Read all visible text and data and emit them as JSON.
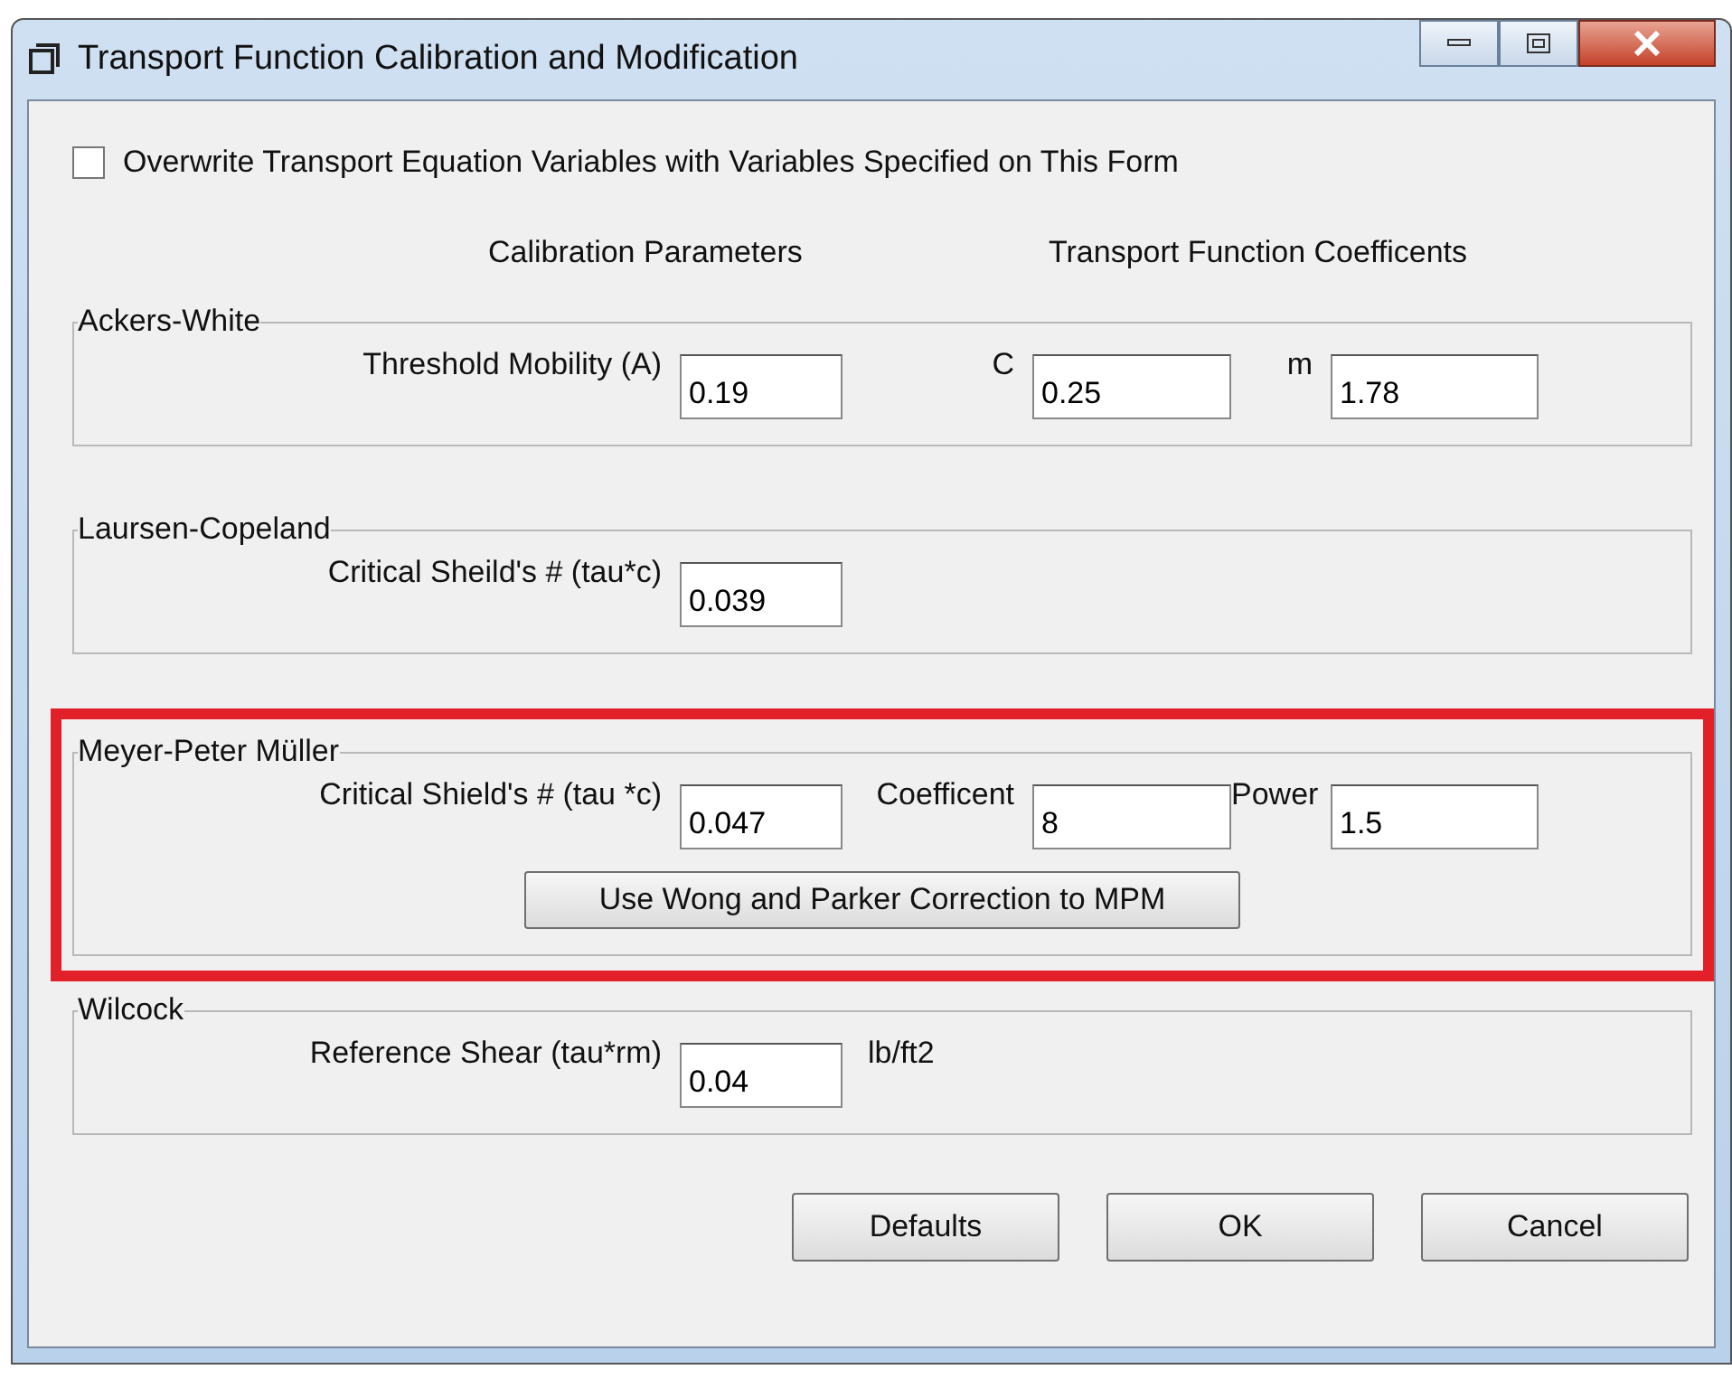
{
  "window": {
    "title": "Transport Function Calibration and Modification"
  },
  "overwrite": {
    "label": "Overwrite Transport Equation Variables with Variables Specified on This Form",
    "checked": false
  },
  "column_headers": [
    "Calibration Parameters",
    "Transport Function Coefficents"
  ],
  "groups": [
    {
      "title": "Ackers-White",
      "highlighted": false,
      "fields": [
        {
          "label": "Threshold Mobility (A)",
          "value": "0.19"
        },
        {
          "label": "C",
          "value": "0.25"
        },
        {
          "label": "m",
          "value": "1.78"
        }
      ]
    },
    {
      "title": "Laursen-Copeland",
      "highlighted": false,
      "fields": [
        {
          "label": "Critical Sheild's # (tau*c)",
          "value": "0.039"
        }
      ]
    },
    {
      "title": "Meyer-Peter Müller",
      "highlighted": true,
      "fields": [
        {
          "label": "Critical Shield's # (tau *c)",
          "value": "0.047"
        },
        {
          "label": "Coefficent",
          "value": "8"
        },
        {
          "label": "Power",
          "value": "1.5"
        }
      ],
      "button": "Use Wong and Parker Correction to MPM"
    },
    {
      "title": "Wilcock",
      "highlighted": false,
      "fields": [
        {
          "label": "Reference Shear (tau*rm)",
          "value": "0.04",
          "unit": "lb/ft2"
        }
      ]
    }
  ],
  "buttons": [
    "Defaults",
    "OK",
    "Cancel"
  ]
}
